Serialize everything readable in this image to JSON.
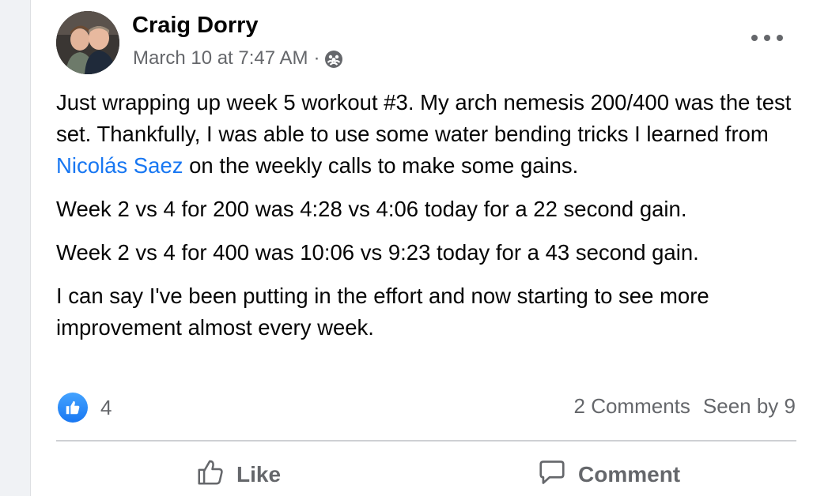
{
  "post": {
    "author": "Craig Dorry",
    "timestamp": "March 10 at 7:47 AM",
    "separator": "·",
    "audience_icon": "group-audience-icon",
    "menu_icon": "more-options-icon",
    "paragraphs": {
      "p1_before": "Just wrapping up week 5 workout #3.  My arch nemesis 200/400 was the test set.  Thankfully, I was able to use some water bending tricks I learned from ",
      "p1_mention": "Nicolás Saez",
      "p1_after": " on the weekly calls to make some gains.",
      "p2": "Week 2 vs 4 for 200 was 4:28 vs 4:06 today for a 22 second gain.",
      "p3": "Week 2 vs 4 for 400 was 10:06 vs 9:23 today for a 43 second gain.",
      "p4": "I can say I've been putting in the effort and now starting to see more improvement almost every week."
    },
    "reactions": {
      "icon": "like-reaction-icon",
      "count": "4"
    },
    "stats": {
      "comments": "2 Comments",
      "seen_by": "Seen by 9"
    },
    "actions": {
      "like_label": "Like",
      "comment_label": "Comment"
    }
  },
  "colors": {
    "link": "#1877f2",
    "secondary_text": "#65676b",
    "primary_text": "#050505",
    "divider": "#ced0d4"
  }
}
